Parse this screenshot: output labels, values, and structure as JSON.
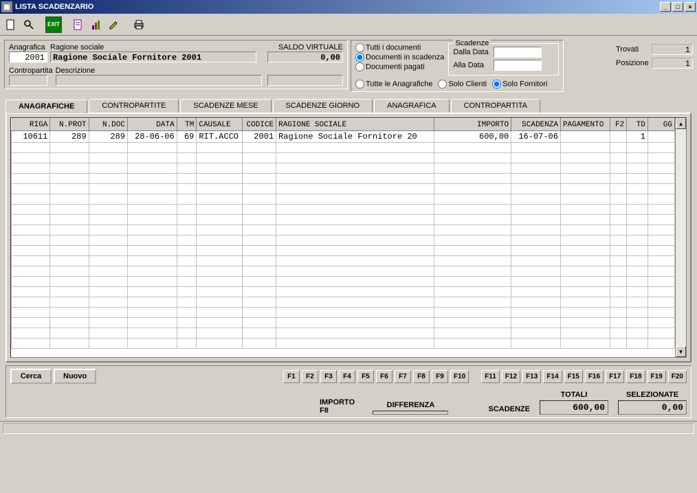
{
  "window": {
    "title": "LISTA SCADENZARIO"
  },
  "header": {
    "anagrafica_label": "Anagrafica",
    "anagrafica_value": "2001",
    "ragione_label": "Ragione sociale",
    "ragione_value": "Ragione Sociale Fornitore 2001",
    "saldo_label": "SALDO VIRTUALE",
    "saldo_value": "0,00",
    "contropartita_label": "Contropartita",
    "descrizione_label": "Descrizione",
    "contropartita_value": "",
    "descrizione_value": ""
  },
  "filters": {
    "tutti_doc": "Tutti i documenti",
    "doc_scadenza": "Documenti in scadenza",
    "doc_pagati": "Documenti pagati",
    "tutte_anag": "Tutte le Anagrafiche",
    "solo_clienti": "Solo Clienti",
    "solo_fornitori": "Solo Fornitori",
    "scadenze_legend": "Scadenze",
    "dalla_data": "Dalla Data",
    "alla_data": "Alla Data"
  },
  "counters": {
    "trovati_label": "Trovati",
    "trovati_value": "1",
    "posizione_label": "Posizione",
    "posizione_value": "1"
  },
  "tabs": {
    "t1": "ANAGRAFICHE",
    "t2": "CONTROPARTITE",
    "t3": "SCADENZE MESE",
    "t4": "SCADENZE GIORNO",
    "t5": "ANAGRAFICA",
    "t6": "CONTROPARTITA"
  },
  "columns": {
    "riga": "RIGA",
    "nprot": "N.PROT",
    "ndoc": "N.DOC",
    "data": "DATA",
    "tm": "TM",
    "causale": "CAUSALE",
    "codice": "CODICE",
    "ragione": "RAGIONE SOCIALE",
    "importo": "IMPORTO",
    "scadenza": "SCADENZA",
    "pagamento": "PAGAMENTO",
    "f2": "F2",
    "td": "TD",
    "gg": "GG"
  },
  "rows": [
    {
      "riga": "10611",
      "nprot": "289",
      "ndoc": "289",
      "data": "28-06-06",
      "tm": "69",
      "causale": "RIT.ACCO",
      "codice": "2001",
      "ragione": "Ragione Sociale Fornitore 20",
      "importo": "600,00",
      "scadenza": "16-07-06",
      "pagamento": "",
      "f2": "",
      "td": "1",
      "gg": ""
    }
  ],
  "buttons": {
    "cerca": "Cerca",
    "nuovo": "Nuovo",
    "f1": "F1",
    "f2": "F2",
    "f3": "F3",
    "f4": "F4",
    "f5": "F5",
    "f6": "F6",
    "f7": "F7",
    "f8": "F8",
    "f9": "F9",
    "f10": "F10",
    "f11": "F11",
    "f12": "F12",
    "f13": "F13",
    "f14": "F14",
    "f15": "F15",
    "f16": "F16",
    "f17": "F17",
    "f18": "F18",
    "f19": "F19",
    "f20": "F20"
  },
  "totals": {
    "importo_f8": "IMPORTO F8",
    "differenza": "DIFFERENZA",
    "differenza_value": "",
    "scadenze_label": "SCADENZE",
    "totali_label": "TOTALI",
    "totali_value": "600,00",
    "selezionate_label": "SELEZIONATE",
    "selezionate_value": "0,00"
  }
}
